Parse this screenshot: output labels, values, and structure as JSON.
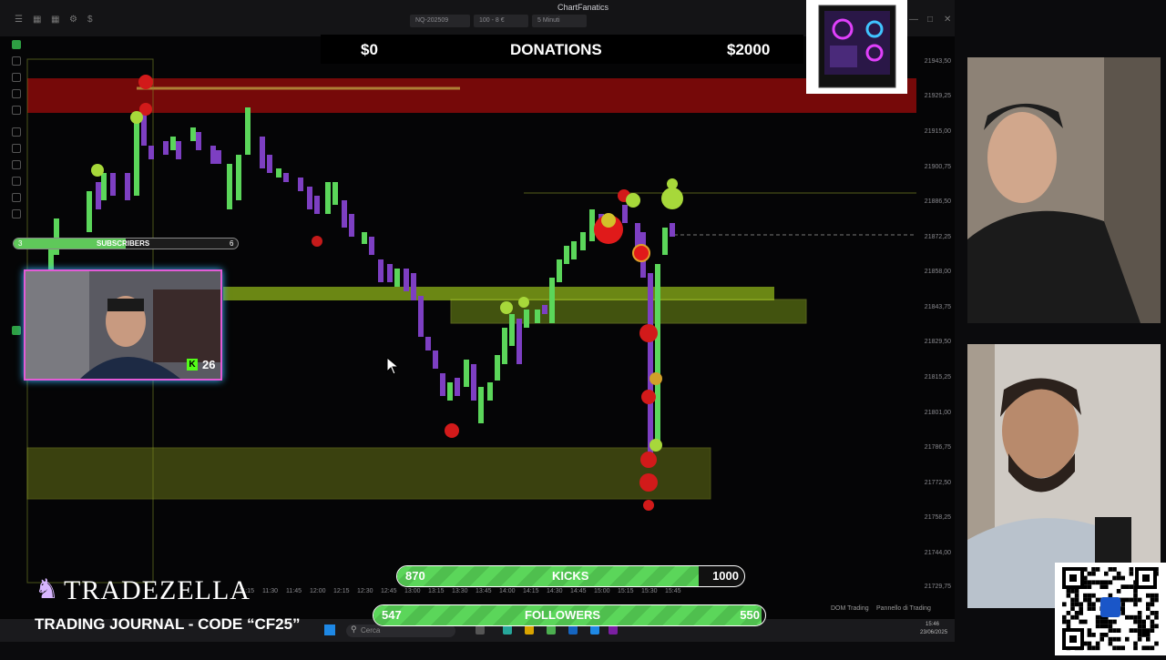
{
  "app": {
    "brand": "ChartFanatics",
    "toolbar_dropdowns": [
      "NQ-202509",
      "100 - 8 €",
      "5 Minuti"
    ]
  },
  "donations": {
    "start": "$0",
    "title": "DONATIONS",
    "goal": "$2000"
  },
  "subscribers": {
    "label": "SUBSCRIBERS",
    "current": "3",
    "goal": "6",
    "progress": 0.5
  },
  "kicks": {
    "current": "870",
    "label": "KICKS",
    "goal": "1000",
    "progress": 0.87
  },
  "followers": {
    "current": "547",
    "label": "FOLLOWERS",
    "goal": "550",
    "progress": 0.99
  },
  "kick_badge": {
    "count": "26"
  },
  "sponsor": {
    "name": "TRADEZELLA",
    "tagline": "TRADING JOURNAL - CODE “CF25”"
  },
  "price_axis": [
    "21943,50",
    "21929,25",
    "21915,00",
    "21900,75",
    "21886,50",
    "21872,25",
    "21858,00",
    "21843,75",
    "21829,50",
    "21815,25",
    "21801,00",
    "21786,75",
    "21772,50",
    "21758,25",
    "21744,00",
    "21729,75"
  ],
  "time_axis": [
    "11:15",
    "11:30",
    "11:45",
    "12:00",
    "12:15",
    "12:30",
    "12:45",
    "13:00",
    "13:15",
    "13:30",
    "13:45",
    "14:00",
    "14:15",
    "14:30",
    "14:45",
    "15:00",
    "15:15",
    "15:30",
    "15:45"
  ],
  "status": {
    "left": "DOM Trading",
    "right": "Pannello di Trading"
  },
  "taskbar": {
    "search_placeholder": "Cerca",
    "clock_time": "15:46",
    "clock_date": "23/06/2025"
  },
  "colors": {
    "bull": "#5bd65a",
    "bear": "#7d3fc2",
    "resistance": "#8b0a0a",
    "zone": "#7b8a1a"
  },
  "icons": [
    "kick-logo-icon",
    "search-icon",
    "windows-start-icon",
    "qr-code-icon"
  ]
}
